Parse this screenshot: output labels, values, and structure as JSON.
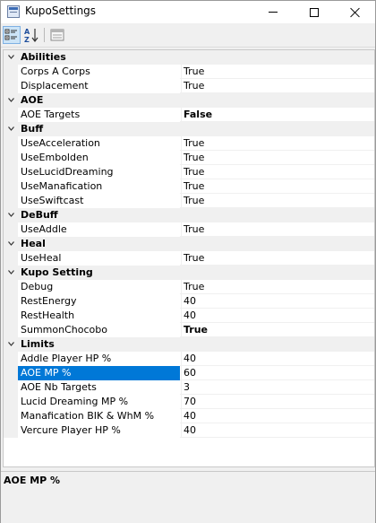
{
  "window": {
    "title": "KupoSettings"
  },
  "toolbar": {
    "buttons": [
      {
        "name": "categorized-view-icon",
        "active": true
      },
      {
        "name": "alphabetical-sort-icon",
        "active": false
      },
      {
        "name": "property-pages-icon",
        "active": false
      }
    ]
  },
  "grid": {
    "categories": [
      {
        "label": "Abilities",
        "properties": [
          {
            "name": "Corps A Corps",
            "value": "True",
            "bold": false
          },
          {
            "name": "Displacement",
            "value": "True",
            "bold": false
          }
        ]
      },
      {
        "label": "AOE",
        "properties": [
          {
            "name": "AOE Targets",
            "value": "False",
            "bold": true
          }
        ]
      },
      {
        "label": "Buff",
        "properties": [
          {
            "name": "UseAcceleration",
            "value": "True",
            "bold": false
          },
          {
            "name": "UseEmbolden",
            "value": "True",
            "bold": false
          },
          {
            "name": "UseLucidDreaming",
            "value": "True",
            "bold": false
          },
          {
            "name": "UseManafication",
            "value": "True",
            "bold": false
          },
          {
            "name": "UseSwiftcast",
            "value": "True",
            "bold": false
          }
        ]
      },
      {
        "label": "DeBuff",
        "properties": [
          {
            "name": "UseAddle",
            "value": "True",
            "bold": false
          }
        ]
      },
      {
        "label": "Heal",
        "properties": [
          {
            "name": "UseHeal",
            "value": "True",
            "bold": false
          }
        ]
      },
      {
        "label": "Kupo Setting",
        "properties": [
          {
            "name": "Debug",
            "value": "True",
            "bold": false
          },
          {
            "name": "RestEnergy",
            "value": "40",
            "bold": false
          },
          {
            "name": "RestHealth",
            "value": "40",
            "bold": false
          },
          {
            "name": "SummonChocobo",
            "value": "True",
            "bold": true
          }
        ]
      },
      {
        "label": "Limits",
        "properties": [
          {
            "name": "Addle Player HP %",
            "value": "40",
            "bold": false
          },
          {
            "name": "AOE MP %",
            "value": "60",
            "bold": false,
            "selected": true
          },
          {
            "name": "AOE Nb Targets",
            "value": "3",
            "bold": false
          },
          {
            "name": "Lucid Dreaming MP %",
            "value": "70",
            "bold": false
          },
          {
            "name": "Manafication BIK & WhM %",
            "value": "40",
            "bold": false
          },
          {
            "name": "Vercure Player HP %",
            "value": "40",
            "bold": false
          }
        ]
      }
    ]
  },
  "description": {
    "title": "AOE MP %"
  },
  "colors": {
    "selection": "#0078d7",
    "category_bg": "#f0f0f0"
  }
}
